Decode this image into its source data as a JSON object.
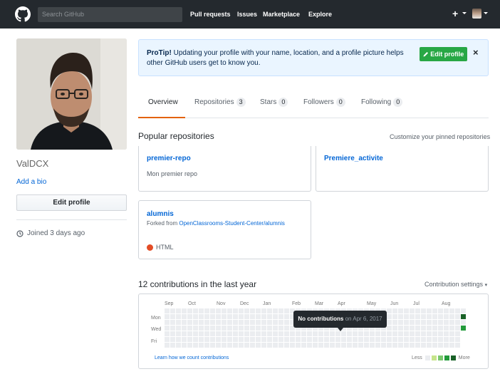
{
  "header": {
    "search_placeholder": "Search GitHub",
    "nav": [
      "Pull requests",
      "Issues",
      "Marketplace",
      "Explore"
    ],
    "new_symbol": "+"
  },
  "profile": {
    "username": "ValDCX",
    "add_bio": "Add a bio",
    "edit_profile": "Edit profile",
    "joined": "Joined 3 days ago"
  },
  "protip": {
    "lead": "ProTip!",
    "text": " Updating your profile with your name, location, and a profile picture helps other GitHub users get to know you.",
    "button": "Edit profile",
    "close": "×"
  },
  "tabs": [
    {
      "label": "Overview",
      "count": null
    },
    {
      "label": "Repositories",
      "count": "3"
    },
    {
      "label": "Stars",
      "count": "0"
    },
    {
      "label": "Followers",
      "count": "0"
    },
    {
      "label": "Following",
      "count": "0"
    }
  ],
  "repos_section": {
    "title": "Popular repositories",
    "customize": "Customize your pinned repositories"
  },
  "repos": [
    {
      "name": "premier-repo",
      "desc": "Mon premier repo"
    },
    {
      "name": "Premiere_activite",
      "desc": ""
    },
    {
      "name": "alumnis",
      "fork_prefix": "Forked from ",
      "fork_source": "OpenClassrooms-Student-Center/alumnis",
      "language": "HTML"
    }
  ],
  "contributions": {
    "title": "12 contributions in the last year",
    "settings": "Contribution settings",
    "months": [
      "Sep",
      "Oct",
      "Nov",
      "Dec",
      "Jan",
      "Feb",
      "Mar",
      "Apr",
      "May",
      "Jun",
      "Jul",
      "Aug"
    ],
    "days": [
      "Mon",
      "Wed",
      "Fri"
    ],
    "tooltip_bold": "No contributions",
    "tooltip_date": " on Apr 6, 2017",
    "learn": "Learn how we count contributions",
    "less": "Less",
    "more": "More",
    "colors": [
      "#ebedf0",
      "#c6e48b",
      "#7bc96f",
      "#239a3b",
      "#196127"
    ]
  }
}
